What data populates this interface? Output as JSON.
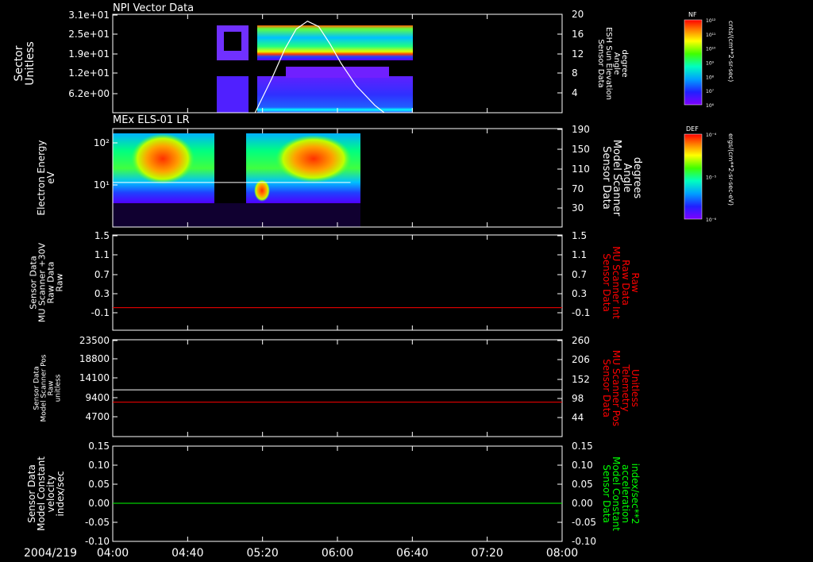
{
  "date_label": "2004/219",
  "time_ticks": [
    "04:00",
    "04:40",
    "05:20",
    "06:00",
    "06:40",
    "07:20",
    "08:00"
  ],
  "time_range": [
    "04:00",
    "08:00"
  ],
  "chart_data": [
    {
      "type": "heatmap",
      "title": "NPI Vector Data",
      "ylabel_left": [
        "Sector",
        "Unitless"
      ],
      "ylabel_right": [
        "Sensor Data",
        "ESH Sun Elevation",
        "Angle",
        "degree"
      ],
      "left_ticks": [
        "3.1e+01",
        "2.5e+01",
        "1.9e+01",
        "1.2e+01",
        "6.2e+00"
      ],
      "left_range": [
        1,
        31
      ],
      "right_ticks": [
        "20",
        "16",
        "12",
        "8",
        "4"
      ],
      "right_range": [
        0,
        20
      ],
      "colorbar": {
        "label": "NF",
        "units": "cnts/(cm**2-sr-sec)",
        "ticks": [
          "10¹²",
          "10¹¹",
          "10¹⁰",
          "10⁹",
          "10⁸",
          "10⁷",
          "10⁶"
        ]
      },
      "series": [
        {
          "name": "ESH Sun Elevation",
          "color": "#ffffff",
          "x": [
            "05:16",
            "05:25",
            "05:32",
            "05:38",
            "05:44",
            "05:50",
            "05:56",
            "06:02",
            "06:10",
            "06:20",
            "06:25"
          ],
          "y": [
            0,
            7,
            13,
            17,
            18.6,
            17.5,
            14,
            10,
            5.5,
            1.5,
            0
          ]
        }
      ],
      "data_blocks": [
        {
          "start": "04:48",
          "end": "05:14",
          "sector_min": 1,
          "sector_max": 31
        },
        {
          "start": "05:18",
          "end": "06:25",
          "sector_min": 1,
          "sector_max": 31
        }
      ]
    },
    {
      "type": "heatmap",
      "title": "MEx ELS-01 LR",
      "ylabel_left": [
        "Electron Energy",
        "eV"
      ],
      "ylabel_right": [
        "Sensor Data",
        "Model Scanner",
        "Angle",
        "degrees"
      ],
      "left_ticks": [
        "10²",
        "10¹"
      ],
      "left_scale": "log",
      "right_ticks": [
        "190",
        "150",
        "110",
        "70",
        "30"
      ],
      "right_range": [
        0,
        190
      ],
      "colorbar": {
        "label": "DEF",
        "units": "ergs/(cm**2-sr-sec-eV)",
        "ticks": [
          "10⁻⁴",
          "10⁻⁵",
          "10⁻⁶"
        ]
      },
      "series": [
        {
          "name": "Model Scanner Angle",
          "color": "#ffffff",
          "x": [
            "04:00",
            "06:07"
          ],
          "y": [
            86,
            86
          ]
        }
      ],
      "data_blocks": [
        {
          "start": "04:00",
          "end": "06:07"
        }
      ]
    },
    {
      "type": "line",
      "ylabel_left": [
        "Sensor Data",
        "MU Scanner +30V",
        "Raw Data",
        "Raw"
      ],
      "ylabel_right": [
        "Sensor Data",
        "MU Scanner Int",
        "Raw Data",
        "Raw"
      ],
      "ylabel_right_color": "#ff0000",
      "left_ticks": [
        "1.5",
        "1.1",
        "0.7",
        "0.3",
        "-0.1"
      ],
      "left_range": [
        -0.4,
        1.5
      ],
      "right_ticks": [
        "1.5",
        "1.1",
        "0.7",
        "0.3",
        "-0.1"
      ],
      "right_range": [
        -0.4,
        1.5
      ],
      "series": [
        {
          "name": "MU Scanner Int",
          "axis": "right",
          "color": "#ff0000",
          "x": [
            "04:00",
            "08:00"
          ],
          "y": [
            0.05,
            0.05
          ]
        }
      ]
    },
    {
      "type": "line",
      "ylabel_left": [
        "Sensor Data",
        "Model Scanner Pos",
        "Raw",
        "unitless"
      ],
      "ylabel_right": [
        "Sensor Data",
        "MU Scanner Pos",
        "Telemetry",
        "Unitless"
      ],
      "ylabel_right_color": "#ff0000",
      "left_ticks": [
        "23500",
        "18800",
        "14100",
        "9400",
        "4700"
      ],
      "left_range": [
        0,
        23500
      ],
      "right_ticks": [
        "260",
        "206",
        "152",
        "98",
        "44"
      ],
      "right_range": [
        -10,
        260
      ],
      "series": [
        {
          "name": "Model Scanner Pos",
          "axis": "left",
          "color": "#ffffff",
          "x": [
            "04:00",
            "08:00"
          ],
          "y": [
            11350,
            11350
          ]
        },
        {
          "name": "MU Scanner Pos",
          "axis": "right",
          "color": "#ff0000",
          "x": [
            "04:00",
            "08:00"
          ],
          "y": [
            86,
            86
          ]
        }
      ]
    },
    {
      "type": "line",
      "ylabel_left": [
        "Sensor Data",
        "Model Constant",
        "velocity",
        "index/sec"
      ],
      "ylabel_right": [
        "Sensor Data",
        "Model Constant",
        "acceleration",
        "index/sec**2"
      ],
      "ylabel_right_color": "#00ff00",
      "left_ticks": [
        "0.15",
        "0.10",
        "0.05",
        "0.00",
        "-0.05",
        "-0.10"
      ],
      "left_range": [
        -0.1,
        0.15
      ],
      "right_ticks": [
        "0.15",
        "0.10",
        "0.05",
        "0.00",
        "-0.05",
        "-0.10"
      ],
      "right_range": [
        -0.1,
        0.15
      ],
      "series": [
        {
          "name": "Model Constant acceleration",
          "axis": "right",
          "color": "#00ff00",
          "x": [
            "04:00",
            "08:00"
          ],
          "y": [
            0,
            0
          ]
        }
      ]
    }
  ]
}
